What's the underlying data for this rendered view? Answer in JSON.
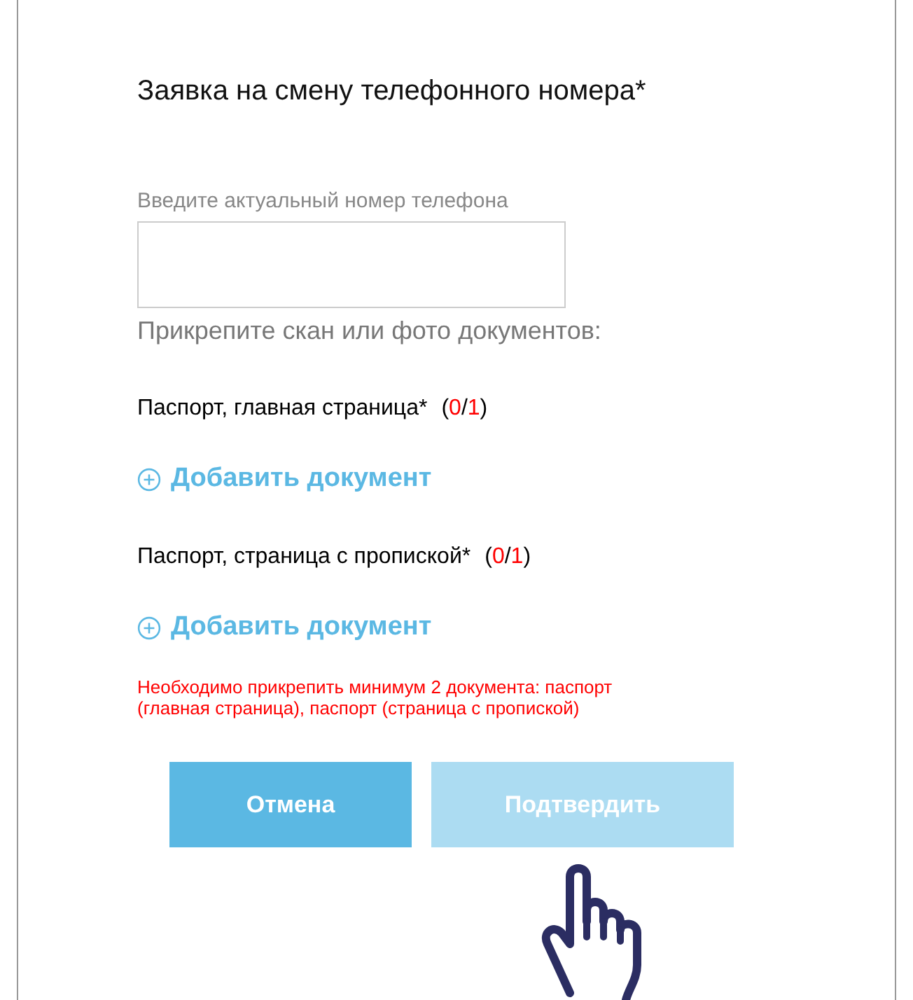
{
  "title": "Заявка на смену телефонного номера*",
  "phone_field": {
    "label": "Введите актуальный номер телефона"
  },
  "attach_prompt": "Прикрепите скан или фото документов:",
  "documents": [
    {
      "label": "Паспорт, главная страница*",
      "counter": [
        {
          "text": "(",
          "kind": "plain"
        },
        {
          "text": "0",
          "kind": "alert"
        },
        {
          "text": "/",
          "kind": "plain"
        },
        {
          "text": "1",
          "kind": "alert"
        },
        {
          "text": ")",
          "kind": "plain"
        }
      ],
      "add_link": "Добавить документ"
    },
    {
      "label": "Паспорт, страница с пропиской*",
      "counter": [
        {
          "text": "(",
          "kind": "plain"
        },
        {
          "text": "0",
          "kind": "alert"
        },
        {
          "text": "/",
          "kind": "plain"
        },
        {
          "text": "1",
          "kind": "alert"
        },
        {
          "text": ")",
          "kind": "plain"
        }
      ],
      "add_link": "Добавить документ"
    }
  ],
  "error": "Необходимо прикрепить минимум 2 документа: паспорт (главная страница), паспорт (страница с пропиской)",
  "buttons": [
    {
      "label": "Отмена",
      "disabled": false
    },
    {
      "label": "Подтвердить",
      "disabled": true
    }
  ]
}
